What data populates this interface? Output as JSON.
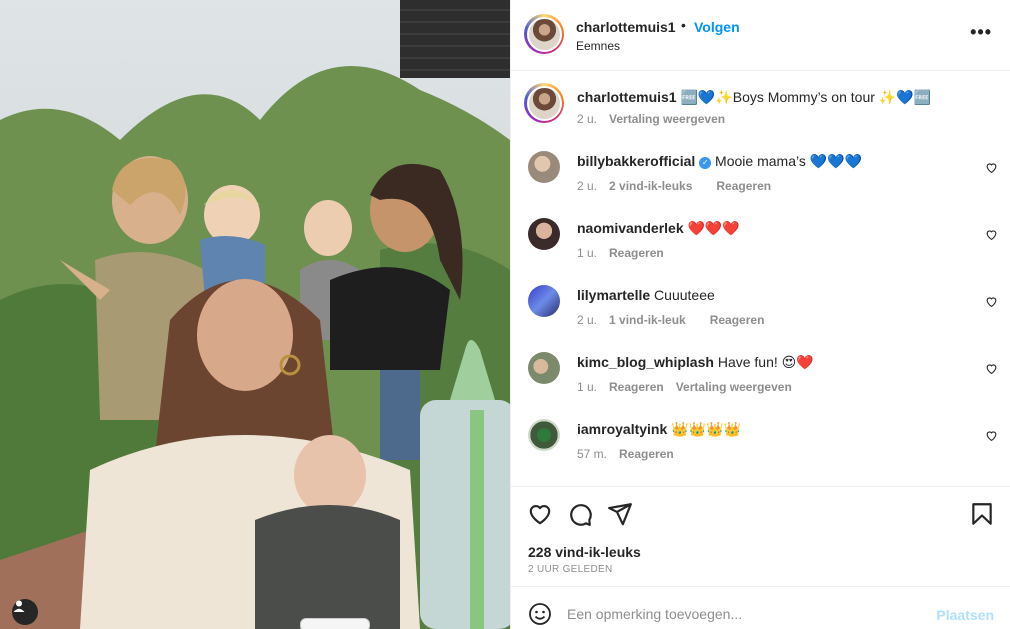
{
  "post": {
    "username": "charlottemuis1",
    "follow_label": "Volgen",
    "separator": "•",
    "location": "Eemnes",
    "more": "•••"
  },
  "caption": {
    "username": "charlottemuis1",
    "text": " 🆓💙✨Boys Mommy’s on tour ✨💙🆓",
    "time": "2 u.",
    "translate": "Vertaling weergeven"
  },
  "comments": [
    {
      "username": "billybakkerofficial",
      "verified": true,
      "text": " Mooie mama’s 💙💙💙",
      "time": "2 u.",
      "likes": "2 vind-ik-leuks",
      "reply": "Reageren",
      "translate": "",
      "avatar_color": "#9a8a7a"
    },
    {
      "username": "naomivanderlek",
      "verified": false,
      "text": " ❤️❤️❤️",
      "time": "1 u.",
      "likes": "",
      "reply": "Reageren",
      "translate": "",
      "avatar_color": "#4a3a3a"
    },
    {
      "username": "lilymartelle",
      "verified": false,
      "text": " Cuuuteee",
      "time": "2 u.",
      "likes": "1 vind-ik-leuk",
      "reply": "Reageren",
      "translate": "",
      "avatar_color": "#5b6bd8"
    },
    {
      "username": "kimc_blog_whiplash",
      "verified": false,
      "text": " Have fun! 😍❤️",
      "time": "1 u.",
      "likes": "",
      "reply": "Reageren",
      "translate": "Vertaling weergeven",
      "avatar_color": "#7b8a6a"
    },
    {
      "username": "iamroyaltyink",
      "verified": false,
      "text": " 👑👑👑👑",
      "time": "57 m.",
      "likes": "",
      "reply": "Reageren",
      "translate": "",
      "avatar_color": "#3f5a3a"
    }
  ],
  "actions": {
    "likes": "228 vind-ik-leuks",
    "time_ago": "2 UUR GELEDEN"
  },
  "add_comment": {
    "placeholder": "Een opmerking toevoegen...",
    "post_label": "Plaatsen"
  },
  "colors": {
    "accent": "#0095f6",
    "muted": "#8e8e8e",
    "post_disabled": "#b2dffc"
  },
  "icons": [
    "heart-icon",
    "comment-icon",
    "share-icon",
    "bookmark-icon",
    "emoji-icon",
    "user-tag-icon",
    "more-icon",
    "verified-icon"
  ]
}
